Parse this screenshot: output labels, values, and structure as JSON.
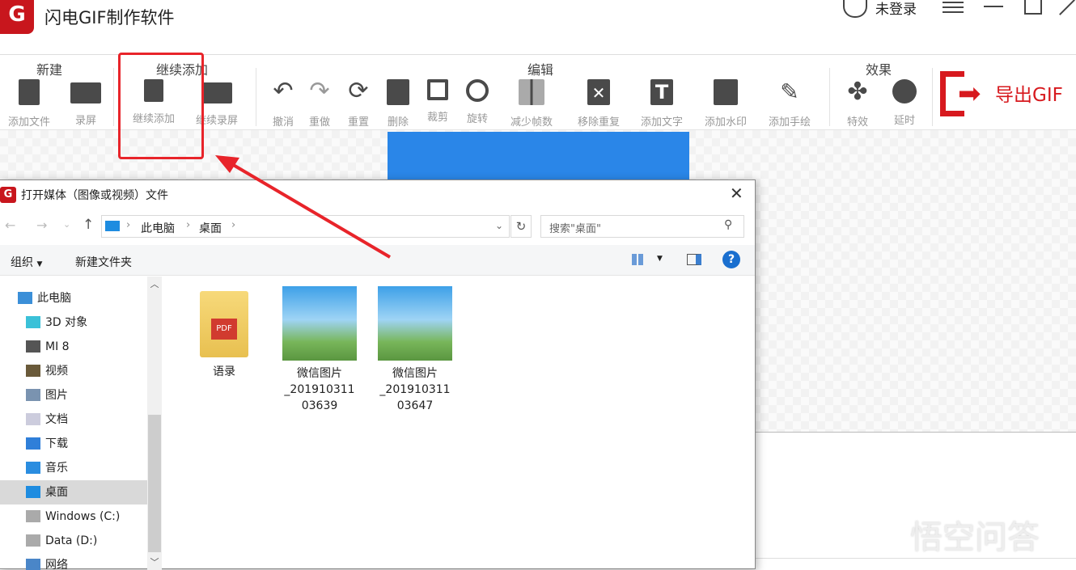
{
  "app": {
    "title": "闪电GIF制作软件",
    "logo_letter": "G",
    "user_label": "未登录"
  },
  "toolbar": {
    "groups": [
      "新建",
      "继续添加",
      "编辑",
      "效果"
    ],
    "buttons": [
      "添加文件",
      "录屏",
      "继续添加",
      "继续录屏",
      "撤消",
      "重做",
      "重置",
      "删除",
      "裁剪",
      "旋转",
      "减少帧数",
      "移除重复",
      "添加文字",
      "添加水印",
      "添加手绘",
      "特效",
      "延时"
    ],
    "export_label": "导出GIF"
  },
  "dialog": {
    "title": "打开媒体（图像或视频）文件",
    "breadcrumb": [
      "此电脑",
      "桌面"
    ],
    "search_placeholder": "搜索\"桌面\"",
    "organize": "组织",
    "new_folder": "新建文件夹",
    "nav": [
      {
        "label": "此电脑",
        "icon": "pc-icon"
      },
      {
        "label": "3D 对象",
        "icon": "cube-icon"
      },
      {
        "label": "MI 8",
        "icon": "phone-icon"
      },
      {
        "label": "视频",
        "icon": "video-icon"
      },
      {
        "label": "图片",
        "icon": "picture-icon"
      },
      {
        "label": "文档",
        "icon": "document-icon"
      },
      {
        "label": "下载",
        "icon": "download-icon"
      },
      {
        "label": "音乐",
        "icon": "music-icon"
      },
      {
        "label": "桌面",
        "icon": "desktop-icon",
        "selected": true
      },
      {
        "label": "Windows (C:)",
        "icon": "drive-icon"
      },
      {
        "label": "Data (D:)",
        "icon": "drive-icon"
      },
      {
        "label": "网络",
        "icon": "network-icon"
      }
    ],
    "files": [
      {
        "name": "语录",
        "type": "folder"
      },
      {
        "name": "微信图片_20191031103639",
        "line1": "微信图片",
        "line2": "_201910311",
        "line3": "03639",
        "type": "image"
      },
      {
        "name": "微信图片_20191031103647",
        "line1": "微信图片",
        "line2": "_201910311",
        "line3": "03647",
        "type": "image"
      }
    ]
  },
  "watermark": "悟空问答",
  "colors": {
    "brand": "#d7191e",
    "selection": "#d9d9d9",
    "blue": "#2a86e8"
  }
}
